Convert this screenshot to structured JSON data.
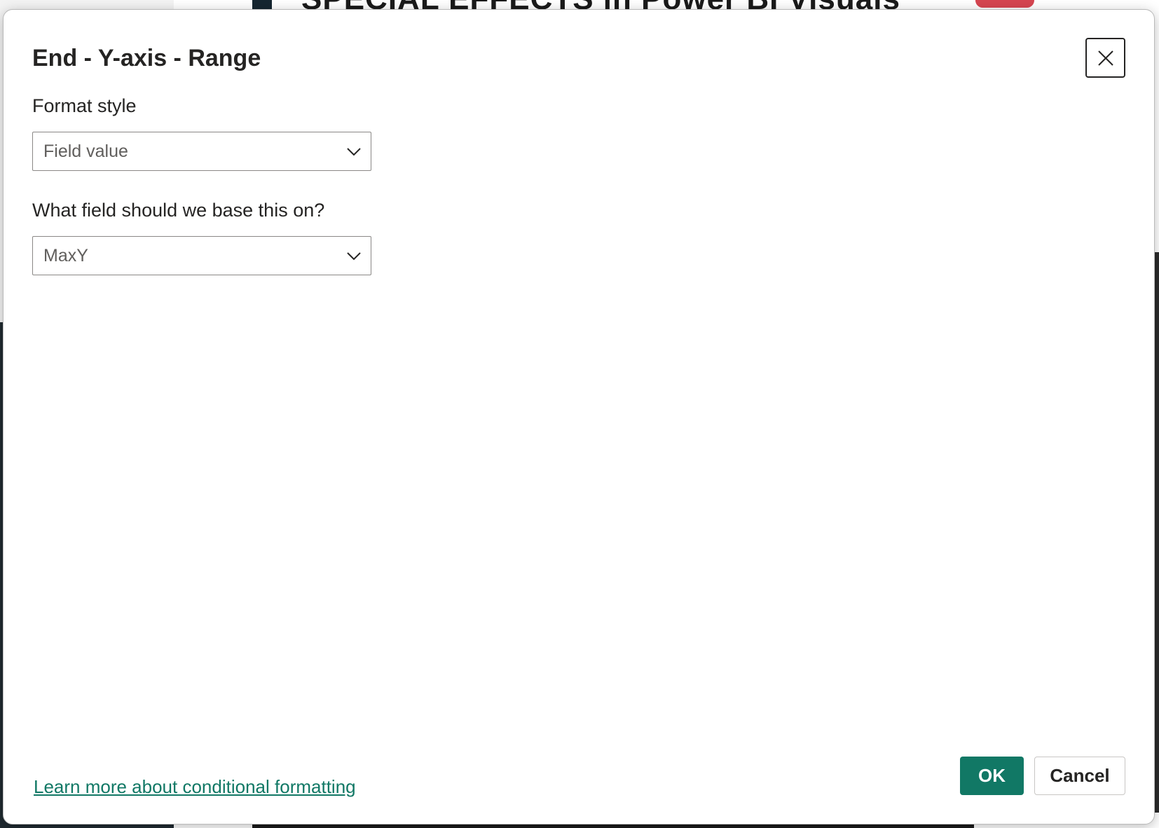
{
  "background": {
    "banner_text": "SPECIAL EFFECTS in Power BI Visuals"
  },
  "dialog": {
    "title": "End - Y-axis - Range",
    "close_icon": "close-icon",
    "format_style": {
      "label": "Format style",
      "selected": "Field value"
    },
    "base_field": {
      "label": "What field should we base this on?",
      "selected": "MaxY"
    },
    "learn_more_link": "Learn more about conditional formatting",
    "ok_label": "OK",
    "cancel_label": "Cancel"
  },
  "colors": {
    "accent": "#117865",
    "text": "#252423",
    "border": "#8a8886"
  }
}
